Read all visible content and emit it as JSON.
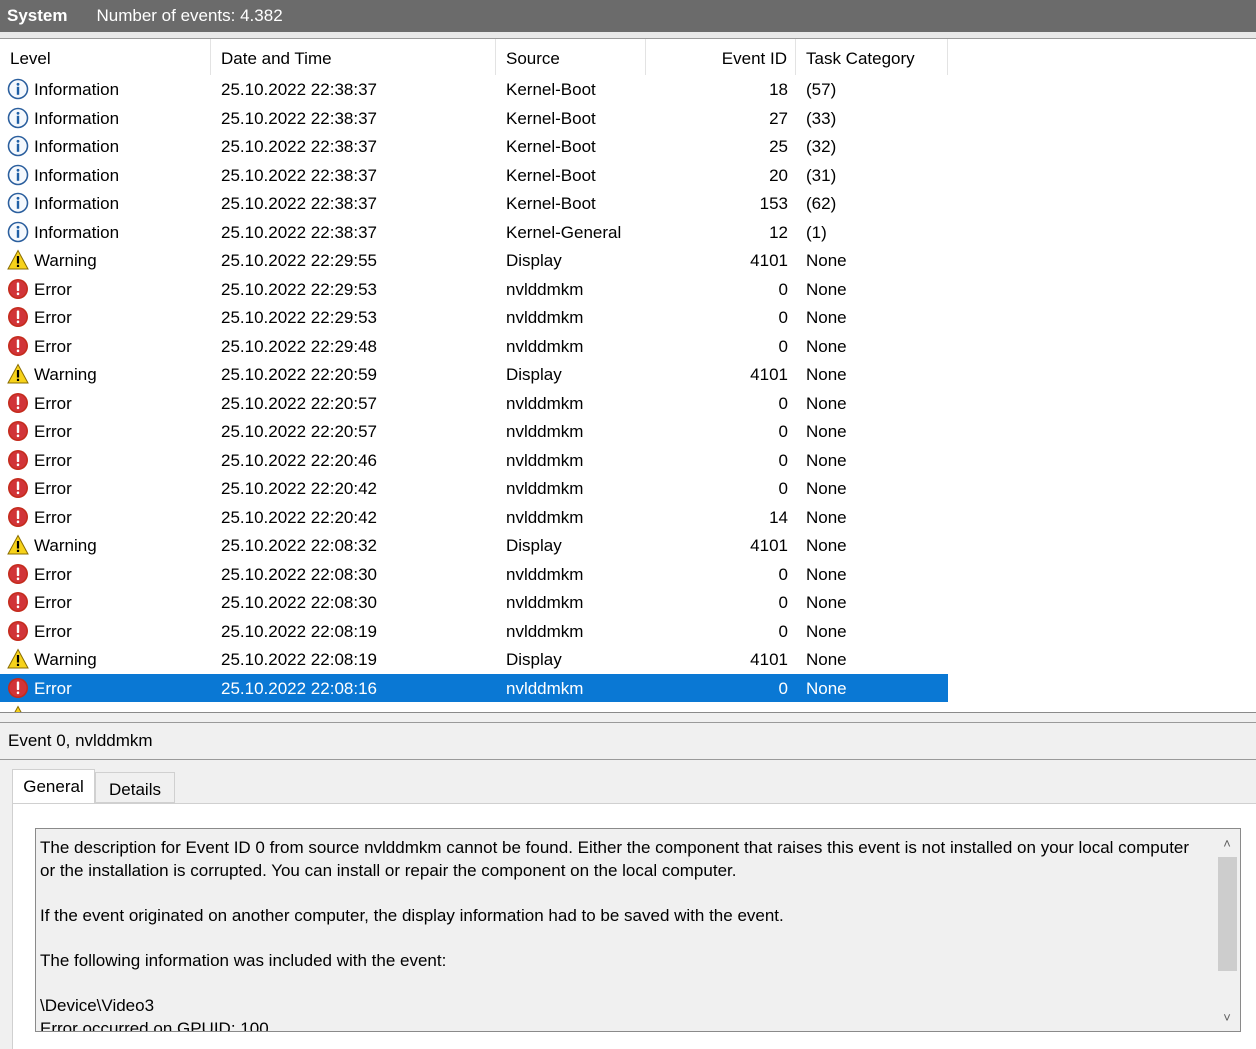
{
  "header": {
    "log_name": "System",
    "event_count": "Number of events: 4.382"
  },
  "columns": {
    "level": "Level",
    "date_time": "Date and Time",
    "source": "Source",
    "event_id": "Event ID",
    "task_category": "Task Category"
  },
  "icons": {
    "Information": "information-icon",
    "Warning": "warning-icon",
    "Error": "error-icon"
  },
  "colors": {
    "selection": "#0a78d4",
    "error": "#d13438",
    "warning": "#f7d21a",
    "info": "#1f5fa6"
  },
  "events": [
    {
      "level": "Information",
      "date": "25.10.2022 22:38:37",
      "source": "Kernel-Boot",
      "id": "18",
      "task": "(57)"
    },
    {
      "level": "Information",
      "date": "25.10.2022 22:38:37",
      "source": "Kernel-Boot",
      "id": "27",
      "task": "(33)"
    },
    {
      "level": "Information",
      "date": "25.10.2022 22:38:37",
      "source": "Kernel-Boot",
      "id": "25",
      "task": "(32)"
    },
    {
      "level": "Information",
      "date": "25.10.2022 22:38:37",
      "source": "Kernel-Boot",
      "id": "20",
      "task": "(31)"
    },
    {
      "level": "Information",
      "date": "25.10.2022 22:38:37",
      "source": "Kernel-Boot",
      "id": "153",
      "task": "(62)"
    },
    {
      "level": "Information",
      "date": "25.10.2022 22:38:37",
      "source": "Kernel-General",
      "id": "12",
      "task": "(1)"
    },
    {
      "level": "Warning",
      "date": "25.10.2022 22:29:55",
      "source": "Display",
      "id": "4101",
      "task": "None"
    },
    {
      "level": "Error",
      "date": "25.10.2022 22:29:53",
      "source": "nvlddmkm",
      "id": "0",
      "task": "None"
    },
    {
      "level": "Error",
      "date": "25.10.2022 22:29:53",
      "source": "nvlddmkm",
      "id": "0",
      "task": "None"
    },
    {
      "level": "Error",
      "date": "25.10.2022 22:29:48",
      "source": "nvlddmkm",
      "id": "0",
      "task": "None"
    },
    {
      "level": "Warning",
      "date": "25.10.2022 22:20:59",
      "source": "Display",
      "id": "4101",
      "task": "None"
    },
    {
      "level": "Error",
      "date": "25.10.2022 22:20:57",
      "source": "nvlddmkm",
      "id": "0",
      "task": "None"
    },
    {
      "level": "Error",
      "date": "25.10.2022 22:20:57",
      "source": "nvlddmkm",
      "id": "0",
      "task": "None"
    },
    {
      "level": "Error",
      "date": "25.10.2022 22:20:46",
      "source": "nvlddmkm",
      "id": "0",
      "task": "None"
    },
    {
      "level": "Error",
      "date": "25.10.2022 22:20:42",
      "source": "nvlddmkm",
      "id": "0",
      "task": "None"
    },
    {
      "level": "Error",
      "date": "25.10.2022 22:20:42",
      "source": "nvlddmkm",
      "id": "14",
      "task": "None"
    },
    {
      "level": "Warning",
      "date": "25.10.2022 22:08:32",
      "source": "Display",
      "id": "4101",
      "task": "None"
    },
    {
      "level": "Error",
      "date": "25.10.2022 22:08:30",
      "source": "nvlddmkm",
      "id": "0",
      "task": "None"
    },
    {
      "level": "Error",
      "date": "25.10.2022 22:08:30",
      "source": "nvlddmkm",
      "id": "0",
      "task": "None"
    },
    {
      "level": "Error",
      "date": "25.10.2022 22:08:19",
      "source": "nvlddmkm",
      "id": "0",
      "task": "None"
    },
    {
      "level": "Warning",
      "date": "25.10.2022 22:08:19",
      "source": "Display",
      "id": "4101",
      "task": "None"
    },
    {
      "level": "Error",
      "date": "25.10.2022 22:08:16",
      "source": "nvlddmkm",
      "id": "0",
      "task": "None",
      "selected": true
    }
  ],
  "detail": {
    "title": "Event 0, nvlddmkm",
    "tabs": [
      "General",
      "Details"
    ],
    "description": [
      "The description for Event ID 0 from source nvlddmkm cannot be found. Either the component that raises this event is not installed on your local computer or the installation is corrupted. You can install or repair the component on the local computer.",
      "",
      "If the event originated on another computer, the display information had to be saved with the event.",
      "",
      "The following information was included with the event:",
      "",
      "\\Device\\Video3",
      "Error occurred on GPUID: 100"
    ]
  }
}
